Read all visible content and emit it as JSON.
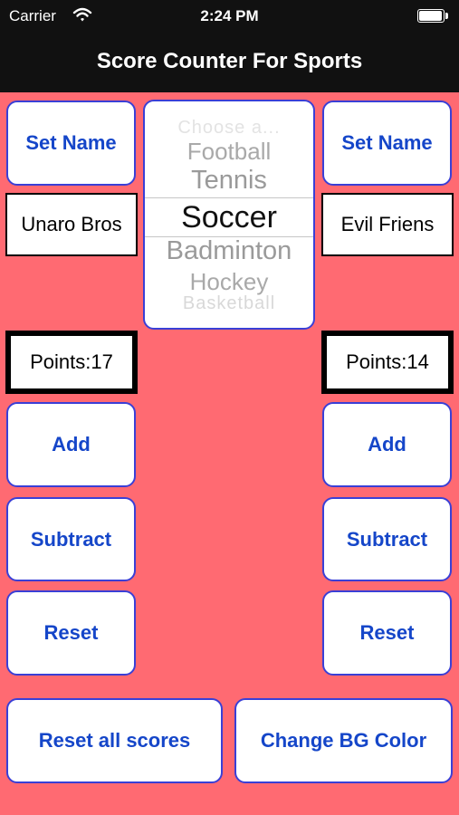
{
  "status_bar": {
    "carrier": "Carrier",
    "time": "2:24 PM",
    "wifi_icon": "wifi-icon",
    "battery_icon": "battery-icon"
  },
  "nav": {
    "title": "Score Counter For Sports"
  },
  "colors": {
    "background": "#ff6a72",
    "button_text": "#1546c9",
    "button_border": "#3a3fd6",
    "bars": "#111111"
  },
  "left_team": {
    "set_name_label": "Set Name",
    "name_value": "Unaro Bros",
    "points_text": "Points:17",
    "add_label": "Add",
    "subtract_label": "Subtract",
    "reset_label": "Reset"
  },
  "right_team": {
    "set_name_label": "Set Name",
    "name_value": "Evil Friens",
    "points_text": "Points:14",
    "add_label": "Add",
    "subtract_label": "Subtract",
    "reset_label": "Reset"
  },
  "picker": {
    "options": [
      "Choose a...",
      "Football",
      "Tennis",
      "Soccer",
      "Badminton",
      "Hockey",
      "Basketball"
    ],
    "selected": "Soccer"
  },
  "footer": {
    "reset_all_label": "Reset all scores",
    "change_bg_label": "Change BG Color"
  }
}
